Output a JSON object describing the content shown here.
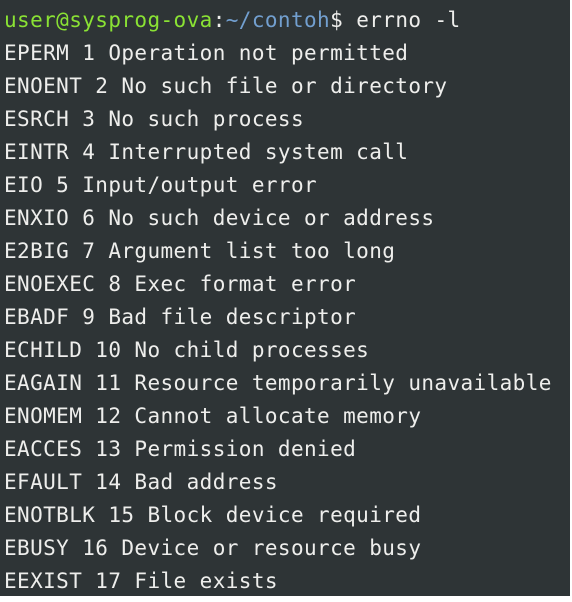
{
  "prompt": {
    "user_host": "user@sysprog-ova",
    "separator": ":",
    "path": "~/contoh",
    "symbol": "$",
    "command": " errno -l"
  },
  "output_lines": [
    "EPERM 1 Operation not permitted",
    "ENOENT 2 No such file or directory",
    "ESRCH 3 No such process",
    "EINTR 4 Interrupted system call",
    "EIO 5 Input/output error",
    "ENXIO 6 No such device or address",
    "E2BIG 7 Argument list too long",
    "ENOEXEC 8 Exec format error",
    "EBADF 9 Bad file descriptor",
    "ECHILD 10 No child processes",
    "EAGAIN 11 Resource temporarily unavailable",
    "ENOMEM 12 Cannot allocate memory",
    "EACCES 13 Permission denied",
    "EFAULT 14 Bad address",
    "ENOTBLK 15 Block device required",
    "EBUSY 16 Device or resource busy",
    "EEXIST 17 File exists"
  ],
  "colors": {
    "background": "#2e3436",
    "foreground": "#eeeeec",
    "user_host": "#8ae234",
    "path": "#729fcf"
  }
}
